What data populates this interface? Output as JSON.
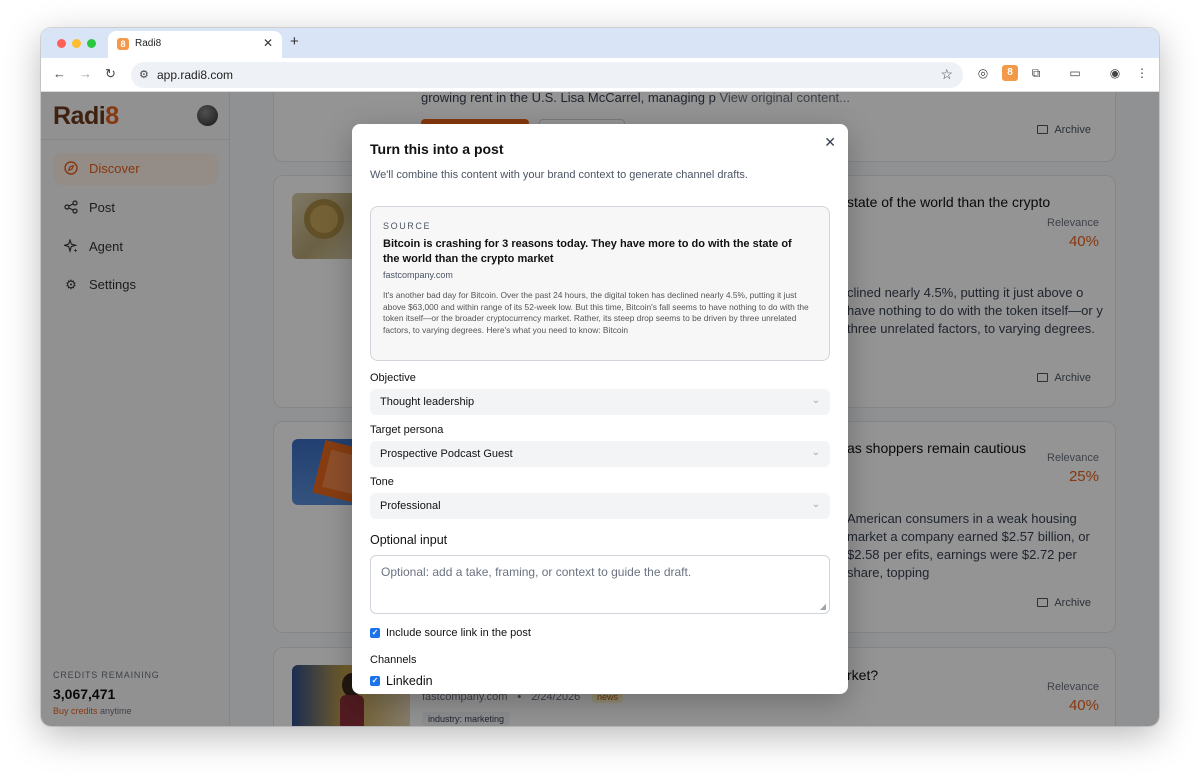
{
  "browser": {
    "tab_title": "Radi8",
    "tab_favicon": "8",
    "url": "app.radi8.com",
    "icons": [
      "back-icon",
      "forward-icon",
      "reload-icon",
      "site-settings-icon",
      "star-icon",
      "extension-icon",
      "puzzle-icon",
      "profile-icon",
      "menu-icon"
    ]
  },
  "sidebar": {
    "logo_main": "Radi",
    "logo_accent": "8",
    "items": [
      {
        "label": "Discover",
        "icon": "compass-icon",
        "active": true
      },
      {
        "label": "Post",
        "icon": "share-icon",
        "active": false
      },
      {
        "label": "Agent",
        "icon": "sparkle-icon",
        "active": false
      },
      {
        "label": "Settings",
        "icon": "gear-icon",
        "active": false
      }
    ],
    "credits_label": "CREDITS REMAINING",
    "credits_value": "3,067,471",
    "buy_link": "Buy credits",
    "buy_suffix": " anytime"
  },
  "feed": {
    "relevance_label": "Relevance",
    "archive_label": "Archive",
    "top_card_excerpt": "growing rent in the U.S. Lisa McCarrel, managing p",
    "view_original": "View original content...",
    "cards": [
      {
        "title": "state of the world than the crypto",
        "relevance": "40%",
        "excerpt": "clined nearly 4.5%, putting it just above o have nothing to do with the token itself—or y three unrelated factors, to varying degrees."
      },
      {
        "title": "as shoppers remain cautious",
        "relevance": "25%",
        "excerpt": "American consumers in a weak housing market a company earned $2.57 billion, or $2.58 per efits, earnings were $2.72 per share, topping"
      },
      {
        "title": "rket?",
        "relevance": "40%",
        "domain": "fastcompany.com",
        "date": "2/24/2026",
        "badge": "news",
        "tag": "industry: marketing"
      }
    ]
  },
  "modal": {
    "title": "Turn this into a post",
    "subtitle": "We'll combine this content with your brand context to generate channel drafts.",
    "source": {
      "label": "SOURCE",
      "title": "Bitcoin is crashing for 3 reasons today. They have more to do with the state of the world than the crypto market",
      "domain": "fastcompany.com",
      "body": "It's another bad day for Bitcoin. Over the past 24 hours, the digital token has declined nearly 4.5%, putting it just above $63,000 and within range of its 52-week low. But this time, Bitcoin's fall seems to have nothing to do with the token itself—or the broader cryptocurrency market. Rather, its steep drop seems to be driven by three unrelated factors, to varying degrees. Here's what you need to know: Bitcoin"
    },
    "objective": {
      "label": "Objective",
      "value": "Thought leadership"
    },
    "persona": {
      "label": "Target persona",
      "value": "Prospective Podcast Guest"
    },
    "tone": {
      "label": "Tone",
      "value": "Professional"
    },
    "optional_input": {
      "label": "Optional input",
      "placeholder": "Optional: add a take, framing, or context to guide the draft."
    },
    "include_source_label": "Include source link in the post",
    "include_source_checked": true,
    "channels_label": "Channels",
    "channels": [
      {
        "label": "Linkedin",
        "checked": true
      }
    ]
  }
}
